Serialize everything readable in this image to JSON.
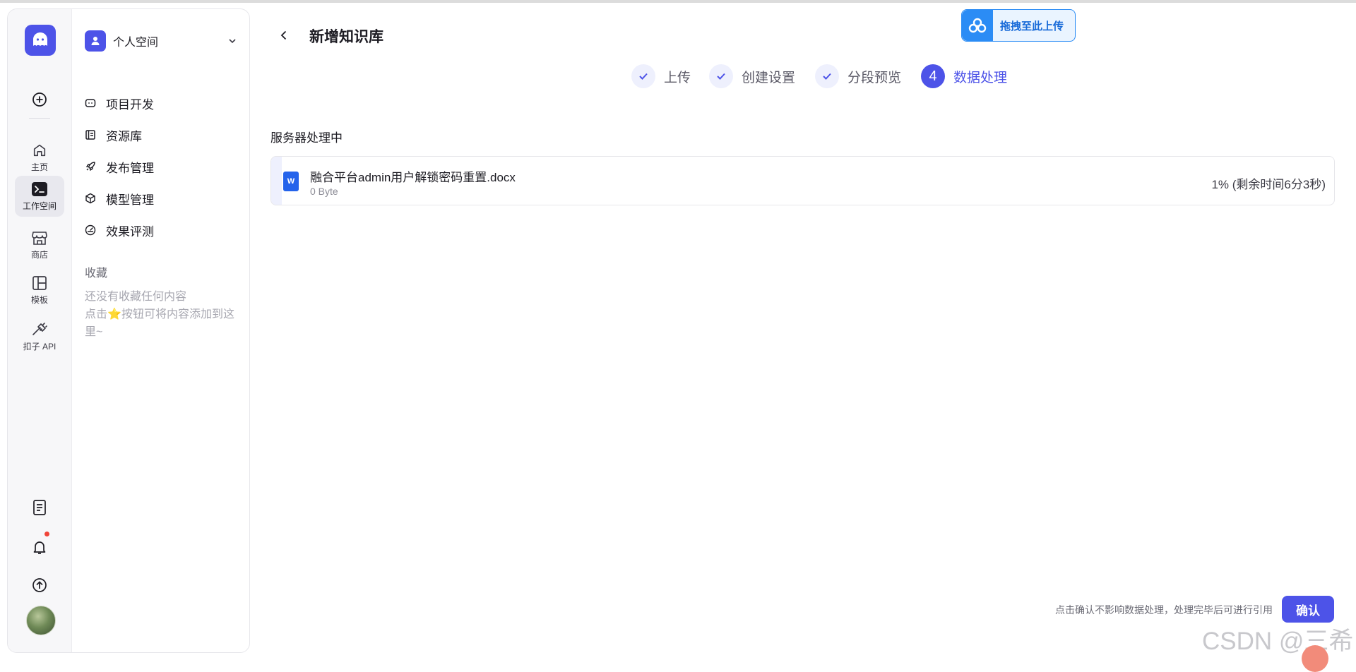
{
  "rail": {
    "items": [
      {
        "label": "主页"
      },
      {
        "label": "工作空间"
      },
      {
        "label": "商店"
      },
      {
        "label": "模板"
      },
      {
        "label": "扣子 API"
      }
    ]
  },
  "sidebar": {
    "space_name": "个人空间",
    "items": [
      {
        "label": "项目开发"
      },
      {
        "label": "资源库"
      },
      {
        "label": "发布管理"
      },
      {
        "label": "模型管理"
      },
      {
        "label": "效果评测"
      }
    ],
    "favorites_title": "收藏",
    "favorites_empty_line1": "还没有收藏任何内容",
    "favorites_empty_prefix": "点击",
    "favorites_star": "⭐",
    "favorites_empty_suffix": "按钮可将内容添加到这里~"
  },
  "header": {
    "title": "新增知识库",
    "upload_badge": "拖拽至此上传"
  },
  "steps": [
    {
      "label": "上传",
      "state": "done"
    },
    {
      "label": "创建设置",
      "state": "done"
    },
    {
      "label": "分段预览",
      "state": "done"
    },
    {
      "label": "数据处理",
      "state": "current",
      "number": "4"
    }
  ],
  "main": {
    "section_title": "服务器处理中",
    "file": {
      "name": "融合平台admin用户解锁密码重置.docx",
      "size": "0 Byte",
      "icon_letter": "W",
      "status": "1% (剩余时间6分3秒)",
      "progress": 0.01
    }
  },
  "footer": {
    "hint": "点击确认不影响数据处理，处理完毕后可进行引用",
    "confirm_label": "确认"
  },
  "watermark": "CSDN @三希",
  "colors": {
    "accent": "#4d53e8",
    "step_bg": "#eef0fd",
    "badge_blue": "#2b8cf5"
  }
}
